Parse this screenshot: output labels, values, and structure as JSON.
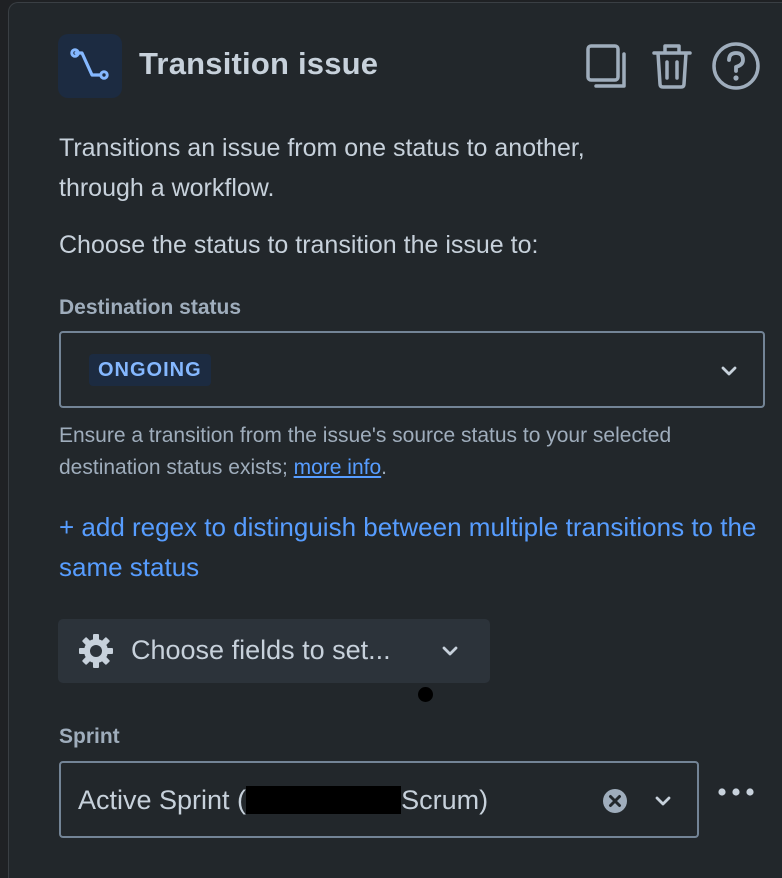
{
  "header": {
    "title": "Transition issue",
    "icon": "transition-icon",
    "actions": [
      {
        "name": "duplicate",
        "icon": "copy-icon"
      },
      {
        "name": "delete",
        "icon": "trash-icon"
      },
      {
        "name": "help",
        "icon": "help-icon"
      }
    ]
  },
  "description": {
    "line1": "Transitions an issue from one status to another,",
    "line2": "through a workflow."
  },
  "choose_prompt": "Choose the status to transition the issue to:",
  "destination_status": {
    "label": "Destination status",
    "value": "ONGOING",
    "helper_text": "Ensure a transition from the issue's source status to your selected destination status exists; ",
    "helper_link": "more info",
    "helper_suffix": "."
  },
  "regex_link": "+ add regex to distinguish between multiple transitions to the same status",
  "choose_fields_button": "Choose fields to set...",
  "sprint": {
    "label": "Sprint",
    "value_prefix": "Active Sprint (",
    "value_suffix": "Scrum)"
  },
  "colors": {
    "panel_bg": "#22272b",
    "text": "#c7d1db",
    "subtle_text": "#9fadbc",
    "link": "#579dff",
    "lozenge_bg": "#1c2b41",
    "lozenge_text": "#85b8ff"
  }
}
